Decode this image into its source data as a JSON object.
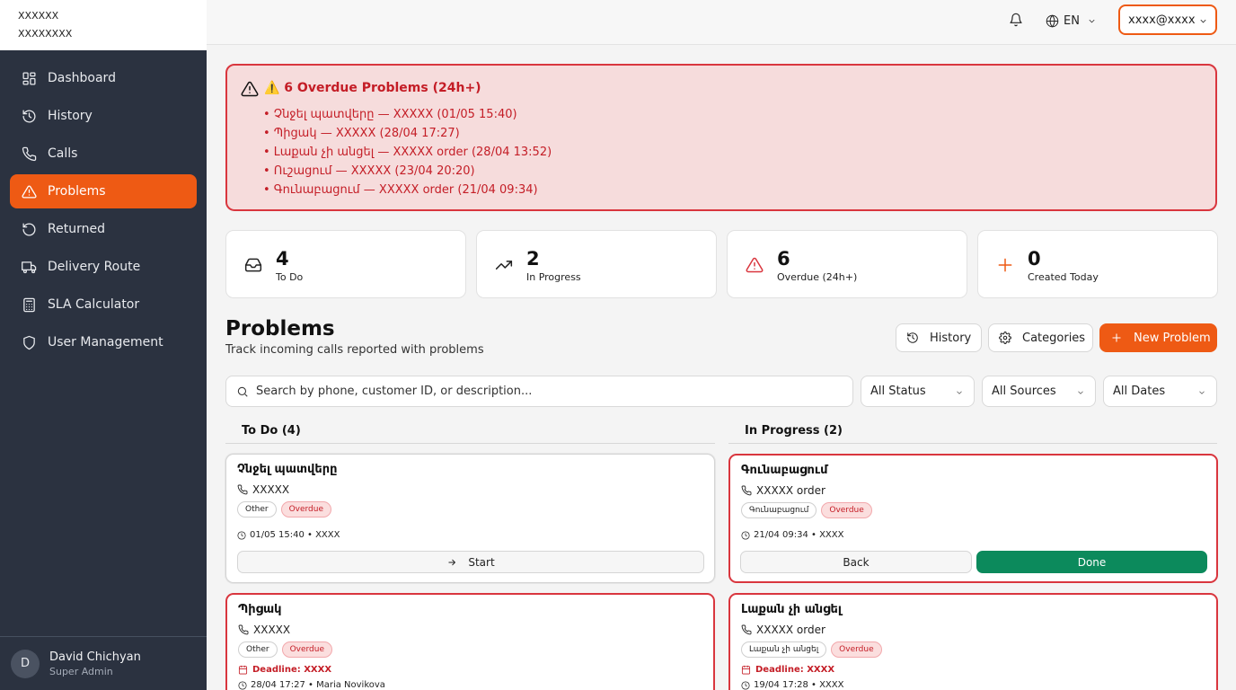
{
  "brand": {
    "line1": "XXXXXX",
    "line2": "XXXXXXXX"
  },
  "sidebar": {
    "items": [
      {
        "label": "Dashboard"
      },
      {
        "label": "History"
      },
      {
        "label": "Calls"
      },
      {
        "label": "Problems"
      },
      {
        "label": "Returned"
      },
      {
        "label": "Delivery Route"
      },
      {
        "label": "SLA Calculator"
      },
      {
        "label": "User Management"
      }
    ],
    "active_index": 3,
    "user": {
      "initial": "D",
      "name": "David Chichyan",
      "role": "Super Admin"
    }
  },
  "topbar": {
    "language": "EN",
    "account": "xxxx@xxxx"
  },
  "alert": {
    "title": "⚠️ 6 Overdue Problems (24h+)",
    "items": [
      "• Չնջել պատվերը — XXXXX (01/05 15:40)",
      "• Պիցակ — XXXXX (28/04 17:27)",
      "• Լաքան չի անցել — XXXXX order (28/04 13:52)",
      "• Ուշացում — XXXXX (23/04 20:20)",
      "• Գունաբացում — XXXXX order (21/04 09:34)"
    ]
  },
  "stats": [
    {
      "value": "4",
      "label": "To Do"
    },
    {
      "value": "2",
      "label": "In Progress"
    },
    {
      "value": "6",
      "label": "Overdue (24h+)"
    },
    {
      "value": "0",
      "label": "Created Today"
    }
  ],
  "problems": {
    "title": "Problems",
    "subtitle": "Track incoming calls reported with problems",
    "history_label": "History",
    "categories_label": "Categories",
    "new_label": "New Problem",
    "search_placeholder": "Search by phone, customer ID, or description...",
    "filters": {
      "status": "All Status",
      "sources": "All Sources",
      "dates": "All Dates"
    }
  },
  "columns": {
    "todo": "To Do (4)",
    "inprogress": "In Progress (2)"
  },
  "cards": {
    "todo1": {
      "title": "Չնջել պատվերը",
      "phone": "XXXXX",
      "category": "Other",
      "overdue": "Overdue",
      "meta": "01/05 15:40 • XXXX",
      "action": "Start"
    },
    "todo2": {
      "title": "Պիցակ",
      "phone": "XXXXX",
      "category": "Other",
      "overdue": "Overdue",
      "deadline": "Deadline: XXXX",
      "meta": "28/04 17:27 • Maria Novikova"
    },
    "prog1": {
      "title": "Գունաբացում",
      "phone": "XXXXX order",
      "category": "Գունաբացում",
      "overdue": "Overdue",
      "meta": "21/04 09:34 • XXXX",
      "back": "Back",
      "done": "Done"
    },
    "prog2": {
      "title": "Լաքան չի անցել",
      "phone": "XXXXX order",
      "category": "Լաքան չի անցել",
      "overdue": "Overdue",
      "deadline": "Deadline: XXXX",
      "meta": "19/04 17:28 • XXXX"
    }
  },
  "colors": {
    "accent": "#ee5a14",
    "danger": "#d9363e",
    "success": "#0c8a5c",
    "sidebar": "#2b3240"
  }
}
